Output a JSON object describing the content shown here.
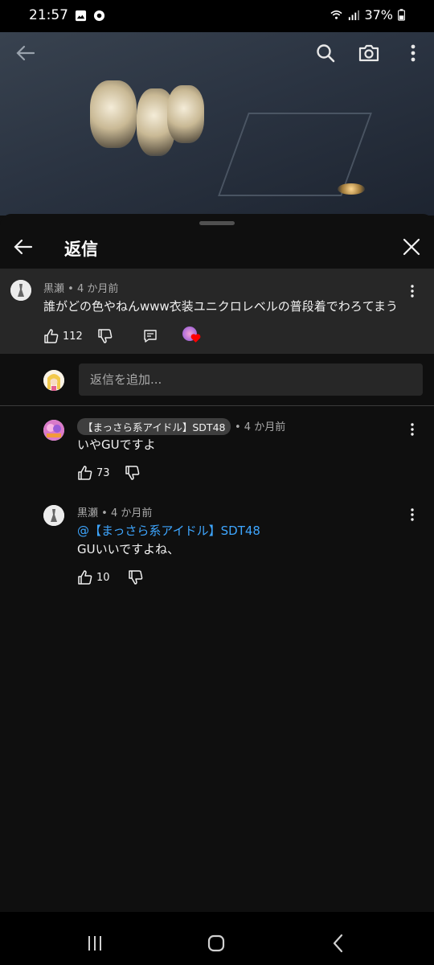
{
  "status_bar": {
    "time": "21:57",
    "battery": "37%",
    "icons": [
      "image-icon",
      "chat-bubble-icon",
      "wifi-icon",
      "signal-icon",
      "battery-icon"
    ]
  },
  "video": {
    "icons": [
      "back-arrow-icon",
      "search-icon",
      "camera-icon",
      "more-vert-icon"
    ]
  },
  "sheet": {
    "title": "返信",
    "parent": {
      "author": "黒瀬",
      "age": "• 4 か月前",
      "text": "誰がどの色やねんwww衣装ユニクロレベルの普段着でわろてまう",
      "likes": "112"
    },
    "reply_input": {
      "placeholder": "返信を追加..."
    },
    "replies": [
      {
        "author": "【まっさら系アイドル】SDT48",
        "age": "• 4 か月前",
        "text": "いやGUですよ",
        "likes": "73"
      },
      {
        "author": "黒瀬",
        "age": "• 4 か月前",
        "mention": "@【まっさら系アイドル】SDT48",
        "text": "GUいいですよね、",
        "likes": "10"
      }
    ]
  },
  "colors": {
    "background": "#0f0f0f",
    "surface": "#272727",
    "text": "#f1f1f1",
    "secondary_text": "#aaaaaa",
    "link": "#3ea6ff",
    "heart": "#ff0000"
  },
  "nav_bar": {
    "icons": [
      "recent-apps-icon",
      "home-icon",
      "back-icon"
    ]
  }
}
